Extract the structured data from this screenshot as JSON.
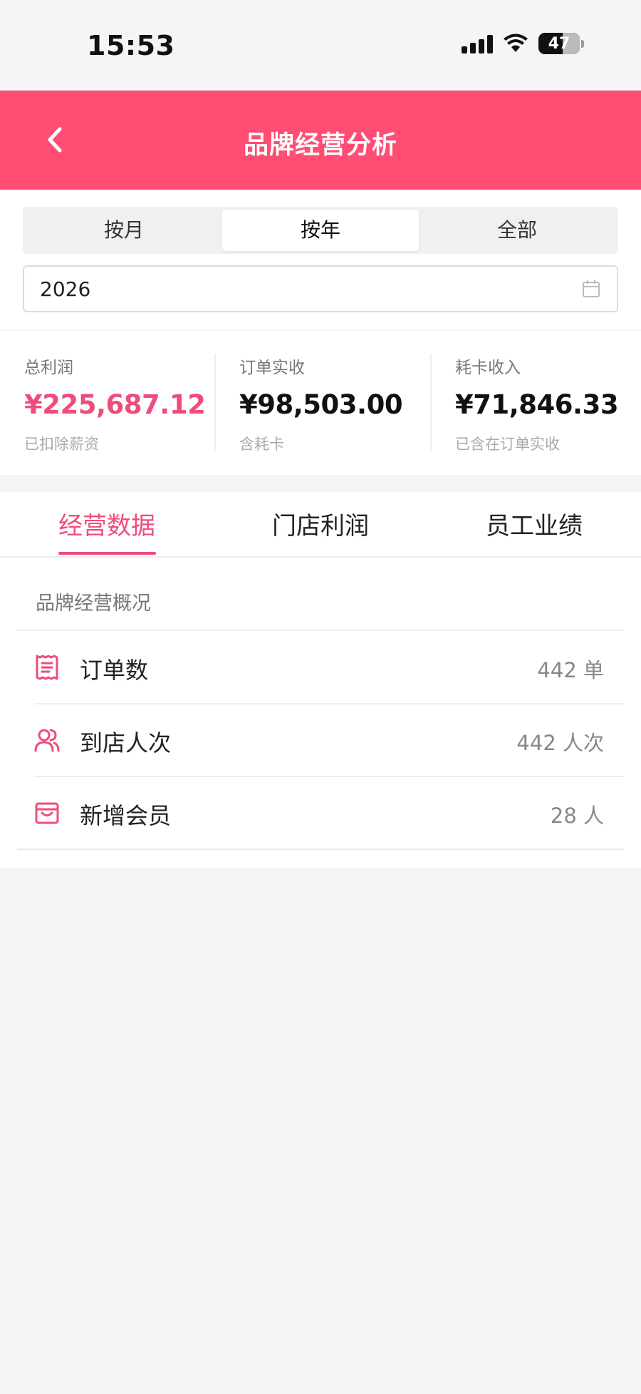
{
  "status_bar": {
    "time": "15:53",
    "battery": "47",
    "icons": [
      "signal-icon",
      "wifi-icon",
      "battery-icon"
    ]
  },
  "nav": {
    "title": "品牌经营分析",
    "back_icon": "chevron-left-icon",
    "color": "#ff4d74"
  },
  "filter": {
    "segments": [
      "按月",
      "按年",
      "全部"
    ],
    "active_segment": "按年",
    "date_value": "2026",
    "date_icon": "calendar-icon"
  },
  "summary": [
    {
      "label": "总利润",
      "value": "¥225,687.12",
      "note": "已扣除薪资",
      "value_color": "#ee4d7b"
    },
    {
      "label": "订单实收",
      "value": "¥98,503.00",
      "note": "含耗卡",
      "value_color": "#111111"
    },
    {
      "label": "耗卡收入",
      "value": "¥71,846.33",
      "note": "已含在订单实收",
      "value_color": "#111111"
    }
  ],
  "tabs": {
    "items": [
      "经营数据",
      "门店利润",
      "员工业绩"
    ],
    "active": "经营数据",
    "accent": "#ee4d7b"
  },
  "overview": {
    "title": "品牌经营概况",
    "rows": [
      {
        "label": "订单数",
        "value": "442 单",
        "icon": "receipt-icon"
      },
      {
        "label": "到店人次",
        "value": "442 人次",
        "icon": "users-icon"
      },
      {
        "label": "新增会员",
        "value": "28 人",
        "icon": "member-card-icon"
      }
    ]
  }
}
